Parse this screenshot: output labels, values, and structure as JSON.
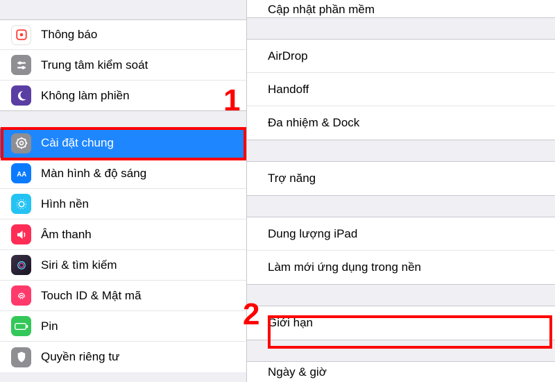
{
  "annotations": {
    "one": "1",
    "two": "2"
  },
  "colors": {
    "accent": "#1e87ff",
    "highlight": "#ff0000",
    "background": "#efeff4"
  },
  "sidebar": {
    "group1": [
      {
        "icon": "notifications-icon",
        "label": "Thông báo",
        "bg": "#ffffff",
        "stroke": "#ff3a30"
      },
      {
        "icon": "control-center-icon",
        "label": "Trung tâm kiểm soát",
        "bg": "#8e8e93"
      },
      {
        "icon": "dnd-icon",
        "label": "Không làm phiền",
        "bg": "#5a3ea3"
      }
    ],
    "group2": [
      {
        "icon": "gear-icon",
        "label": "Cài đặt chung",
        "bg": "#8e8e93",
        "selected": true
      },
      {
        "icon": "display-icon",
        "label": "Màn hình & độ sáng",
        "bg": "#0a7bff"
      },
      {
        "icon": "wallpaper-icon",
        "label": "Hình nền",
        "bg": "#25c2f4"
      },
      {
        "icon": "sound-icon",
        "label": "Âm thanh",
        "bg": "#ff2d55"
      },
      {
        "icon": "siri-icon",
        "label": "Siri & tìm kiếm",
        "bg": "#000000"
      },
      {
        "icon": "touchid-icon",
        "label": "Touch ID & Mật mã",
        "bg": "#ff3a6b"
      },
      {
        "icon": "battery-icon",
        "label": "Pin",
        "bg": "#34c759"
      },
      {
        "icon": "privacy-icon",
        "label": "Quyền riêng tư",
        "bg": "#8e8e93"
      }
    ]
  },
  "detail": {
    "topPartial": "Cập nhật phần mềm",
    "group1": [
      "AirDrop",
      "Handoff",
      "Đa nhiệm & Dock"
    ],
    "group2": [
      "Trợ năng"
    ],
    "group3": [
      "Dung lượng iPad",
      "Làm mới ứng dụng trong nền"
    ],
    "group4": [
      "Giới hạn"
    ],
    "bottomPartial": "Ngày & giờ"
  }
}
